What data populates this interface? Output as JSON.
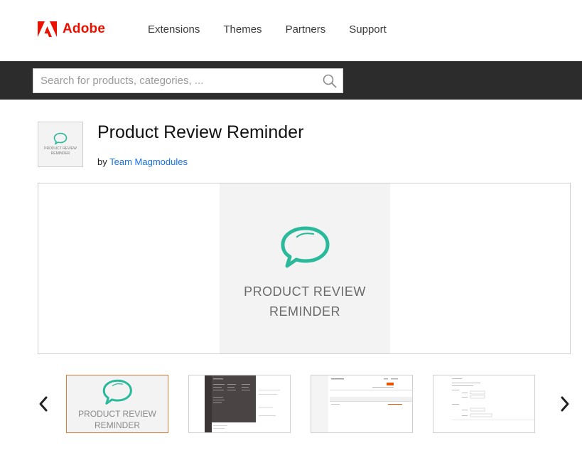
{
  "header": {
    "brand": "Adobe",
    "nav": [
      "Extensions",
      "Themes",
      "Partners",
      "Support"
    ]
  },
  "search": {
    "placeholder": "Search for products, categories, ..."
  },
  "product": {
    "title": "Product Review Reminder",
    "by_label": "by",
    "vendor": "Team Magmodules",
    "image_text_line1": "PRODUCT REVIEW",
    "image_text_line2": "REMINDER"
  },
  "colors": {
    "brand_red": "#eb1000",
    "teal_icon": "#2bb99c",
    "link_blue": "#1473e6",
    "search_band": "#2c2c2c",
    "active_thumb_border": "#d97a3c"
  },
  "icons": {
    "search": "search-icon",
    "prev": "chevron-left-icon",
    "next": "chevron-right-icon"
  }
}
